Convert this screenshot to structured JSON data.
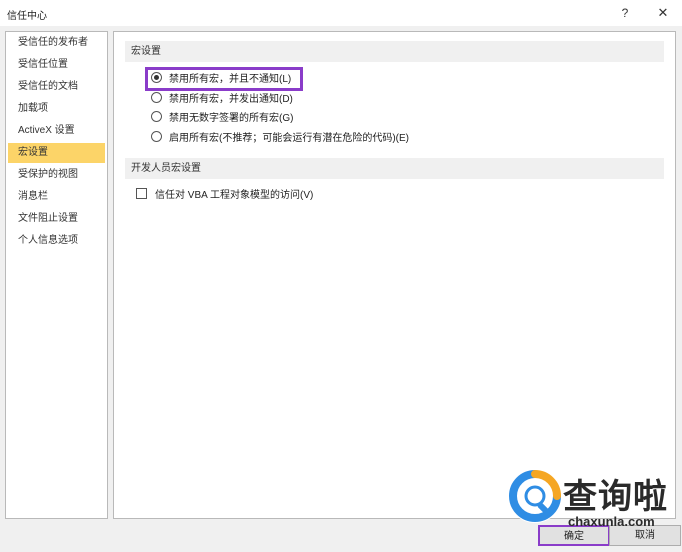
{
  "window": {
    "title": "信任中心",
    "help_label": "?",
    "close_label": "✕"
  },
  "sidebar": {
    "items": [
      {
        "label": "受信任的发布者"
      },
      {
        "label": "受信任位置"
      },
      {
        "label": "受信任的文档"
      },
      {
        "label": "加载项"
      },
      {
        "label": "ActiveX 设置"
      },
      {
        "label": "宏设置",
        "selected": true
      },
      {
        "label": "受保护的视图"
      },
      {
        "label": "消息栏"
      },
      {
        "label": "文件阻止设置"
      },
      {
        "label": "个人信息选项"
      }
    ]
  },
  "macro_settings": {
    "header": "宏设置",
    "options": [
      {
        "label": "禁用所有宏，并且不通知(L)",
        "selected": true
      },
      {
        "label": "禁用所有宏，并发出通知(D)",
        "selected": false
      },
      {
        "label": "禁用无数字签署的所有宏(G)",
        "selected": false
      },
      {
        "label": "启用所有宏(不推荐；可能会运行有潜在危险的代码)(E)",
        "selected": false
      }
    ]
  },
  "developer_settings": {
    "header": "开发人员宏设置",
    "trust_vba_label": "信任对 VBA 工程对象模型的访问(V)",
    "trust_vba_checked": false
  },
  "buttons": {
    "ok": "确定",
    "cancel": "取消"
  },
  "watermark": {
    "brand_cn": "查询啦",
    "brand_en": "chaxunla.com"
  },
  "colors": {
    "selection": "#fcd468",
    "annotation": "#8a3cc9"
  }
}
